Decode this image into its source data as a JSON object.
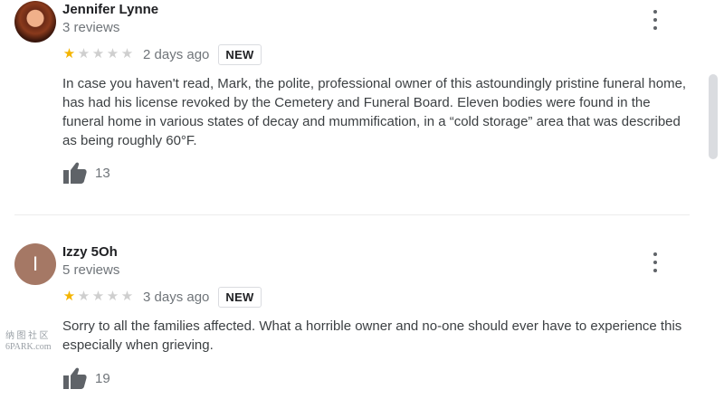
{
  "reviews": [
    {
      "name": "Jennifer Lynne",
      "meta": "3 reviews",
      "stars_filled": 1,
      "stars_total": 5,
      "date": "2 days ago",
      "badge": "NEW",
      "text": "In case you haven't read, Mark, the polite, professional owner of this astoundingly pristine funeral home, has had his license revoked by the Cemetery and Funeral Board. Eleven bodies were found in the funeral home in various states of decay and mummification, in a “cold storage” area that was described as being roughly 60°F.",
      "likes": "13"
    },
    {
      "name": "Izzy 5Oh",
      "meta": "5 reviews",
      "avatar_letter": "I",
      "stars_filled": 1,
      "stars_total": 5,
      "date": "3 days ago",
      "badge": "NEW",
      "text": "Sorry to all the families affected. What a horrible owner and no-one should ever have to experience this especially when grieving.",
      "likes": "19"
    }
  ],
  "watermark": {
    "line1": "纳 图 社 区",
    "line2": "6PARK.com"
  },
  "colors": {
    "star_filled": "#f4b400",
    "star_empty": "#cfcfcf",
    "avatar_letter_bg": "#a57865",
    "secondary_text": "#70757a"
  },
  "icons": {
    "more": "vertical-dots-icon",
    "like": "thumbs-up-icon",
    "star": "star-icon"
  }
}
